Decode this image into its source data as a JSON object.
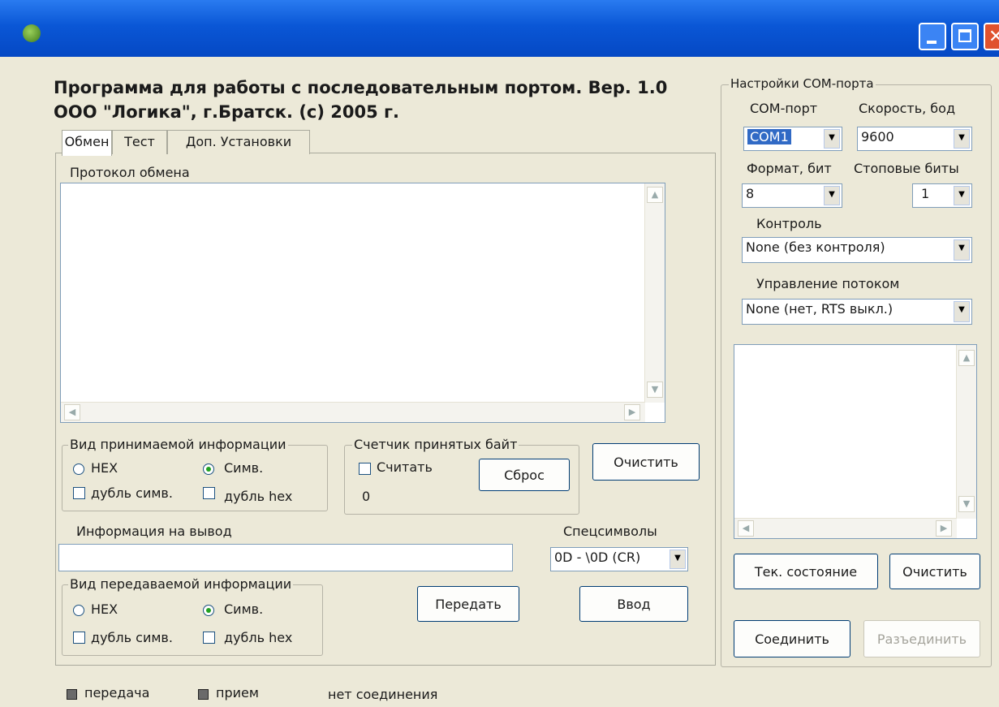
{
  "window": {
    "title": "",
    "heading_line1": "Программа для работы с последовательным портом. Вер. 1.0",
    "heading_line2": "ООО \"Логика\", г.Братск. (с) 2005 г."
  },
  "tabs": [
    {
      "label": "Обмен",
      "active": true
    },
    {
      "label": "Тест",
      "active": false
    },
    {
      "label": "Доп. Установки",
      "active": false
    }
  ],
  "exchange": {
    "protocol_label": "Протокол обмена",
    "receive_group": {
      "title": "Вид принимаемой информации",
      "hex": "HEX",
      "sym": "Симв.",
      "selected": "Симв.",
      "dup_sym": "дубль симв.",
      "dup_hex": "дубль hex"
    },
    "counter_group": {
      "title": "Счетчик принятых байт",
      "count_check": "Считать",
      "reset_button": "Сброс",
      "value": "0"
    },
    "clear_button": "Очистить",
    "output_label": "Информация на вывод",
    "output_value": "",
    "special_label": "Спецсимволы",
    "special_value": "0D - \\0D (CR)",
    "send_group": {
      "title": "Вид передаваемой информации",
      "hex": "HEX",
      "sym": "Симв.",
      "selected": "Симв.",
      "dup_sym": "дубль симв.",
      "dup_hex": "дубль hex"
    },
    "send_button": "Передать",
    "enter_button": "Ввод"
  },
  "com_settings": {
    "title": "Настройки COM-порта",
    "port_label": "COM-порт",
    "port_value": "COM1",
    "speed_label": "Скорость, бод",
    "speed_value": "9600",
    "format_label": "Формат, бит",
    "format_value": "8",
    "stop_label": "Стоповые биты",
    "stop_value": "1",
    "control_label": "Контроль",
    "control_value": "None  (без контроля)",
    "flow_label": "Управление потоком",
    "flow_value": "None  (нет, RTS выкл.)",
    "state_button": "Тек. состояние",
    "clear_button": "Очистить",
    "connect_button": "Соединить",
    "disconnect_button": "Разъединить"
  },
  "status": {
    "tx_label": "передача",
    "rx_label": "прием",
    "connection": "нет соединения"
  }
}
